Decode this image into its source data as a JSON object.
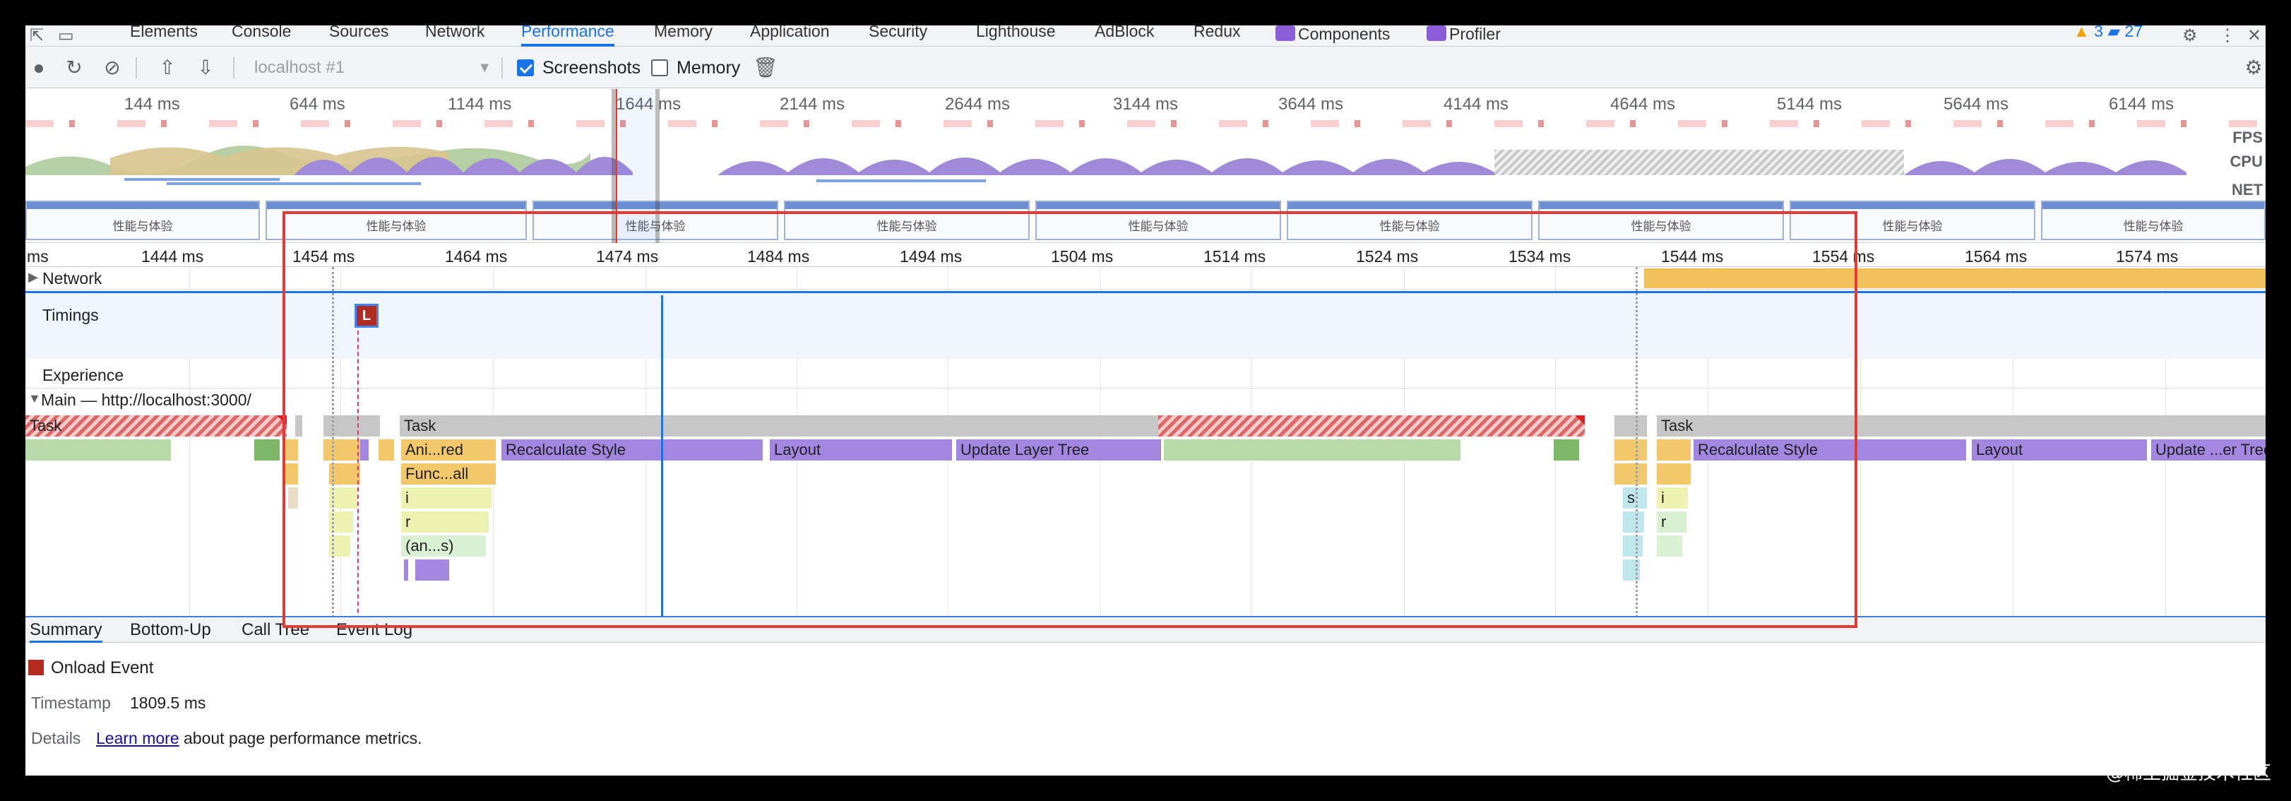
{
  "tabs": {
    "items": [
      "Elements",
      "Console",
      "Sources",
      "Network",
      "Performance",
      "Memory",
      "Application",
      "Security",
      "Lighthouse",
      "AdBlock",
      "Redux",
      "Components",
      "Profiler"
    ],
    "warnings": "3",
    "messages": "27"
  },
  "toolbar": {
    "profile": "localhost #1",
    "screenshots_label": "Screenshots",
    "memory_label": "Memory"
  },
  "overview": {
    "ticks": [
      "144 ms",
      "644 ms",
      "1144 ms",
      "1644 ms",
      "2144 ms",
      "2644 ms",
      "3144 ms",
      "3644 ms",
      "4144 ms",
      "4644 ms",
      "5144 ms",
      "5644 ms",
      "6144 ms"
    ],
    "lane_labels": [
      "FPS",
      "CPU",
      "NET"
    ],
    "screenshot_text": "性能与体验"
  },
  "ruler": {
    "ticks": [
      "ms",
      "1444 ms",
      "1454 ms",
      "1464 ms",
      "1474 ms",
      "1484 ms",
      "1494 ms",
      "1504 ms",
      "1514 ms",
      "1524 ms",
      "1534 ms",
      "1544 ms",
      "1554 ms",
      "1564 ms",
      "1574 ms"
    ]
  },
  "tracks": {
    "network": "Network",
    "timings": "Timings",
    "onload_marker": "L",
    "experience": "Experience",
    "main": "Main — http://localhost:3000/"
  },
  "events": {
    "task": "Task",
    "ani_red": "Ani...red",
    "func_all": "Func...all",
    "i": "i",
    "r": "r",
    "an_s": "(an...s)",
    "s": "s",
    "recalc": "Recalculate Style",
    "layout": "Layout",
    "update_layer_tree": "Update Layer Tree",
    "update_er_tree": "Update ...er Tree"
  },
  "bottom": {
    "tabs": [
      "Summary",
      "Bottom-Up",
      "Call Tree",
      "Event Log"
    ],
    "summary_title": "Onload Event",
    "timestamp_key": "Timestamp",
    "timestamp_value": "1809.5 ms",
    "details_key": "Details",
    "details_link": "Learn more",
    "details_rest": " about page performance metrics."
  },
  "watermark": "@稀土掘金技术社区",
  "colors": {
    "accent": "#1a73e8",
    "highlight": "#e53935",
    "onload": "#b22b20",
    "rendering": "#a386e0",
    "scripting": "#f2c86a"
  }
}
